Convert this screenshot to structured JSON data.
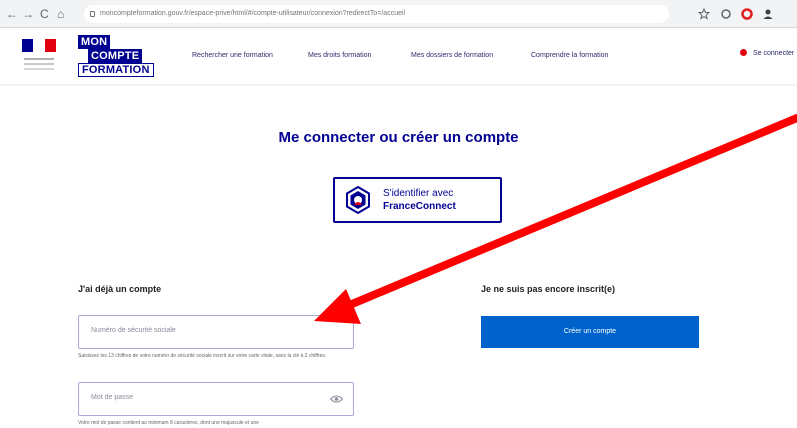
{
  "browser": {
    "url": "moncompteformation.gouv.fr/espace-prive/html/#/compte-utilisateur/connexion?redirectTo=/accueil",
    "controls": [
      "←",
      "→",
      "C",
      "⌂"
    ]
  },
  "header": {
    "brand": [
      "MON",
      "COMPTE",
      "FORMATION"
    ],
    "nav": [
      "Rechercher une formation",
      "Mes droits formation",
      "Mes dossiers de formation",
      "Comprendre la formation"
    ],
    "account": "Se connecter"
  },
  "main": {
    "title": "Me connecter ou créer un compte",
    "franceconnect": [
      "S'identifier avec",
      "FranceConnect"
    ],
    "login": {
      "title": "J'ai déjà un compte",
      "ssn_placeholder": "Numéro de sécurité sociale",
      "ssn_hint": "Saisissez les 13 chiffres de votre numéro de sécurité sociale inscrit sur votre carte vitale, sans la clé à 2 chiffres.",
      "password_placeholder": "Mot de passe",
      "password_hint": "Votre mot de passe contient au minimum 8 caractères, dont une majuscule et une"
    },
    "signup": {
      "title": "Je ne suis pas encore inscrit(e)",
      "button": "Créer un compte"
    }
  },
  "colors": {
    "brand_blue": "#000091",
    "brand_red": "#e1000f",
    "button_blue": "#0063cb",
    "arrow": "#ff0000"
  }
}
